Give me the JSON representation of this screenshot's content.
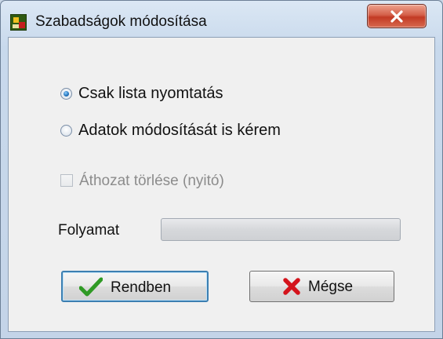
{
  "window": {
    "title": "Szabadságok módosítása",
    "icon": "app-calendar-icon",
    "close_icon": "close-icon"
  },
  "options": {
    "selected": "print_only",
    "print_only_label": "Csak lista nyomtatás",
    "modify_data_label": "Adatok módosítását is kérem"
  },
  "checkbox": {
    "label": "Áthozat törlése (nyitó)",
    "checked": false,
    "enabled": false
  },
  "progress": {
    "label": "Folyamat",
    "value": 0
  },
  "buttons": {
    "ok_label": "Rendben",
    "ok_icon": "checkmark-icon",
    "cancel_label": "Mégse",
    "cancel_icon": "red-x-icon"
  },
  "colors": {
    "accent": "#3c7fb1",
    "ok_icon": "#2f9a25",
    "cancel_icon": "#d4141c",
    "close_button": "#c94a32"
  }
}
